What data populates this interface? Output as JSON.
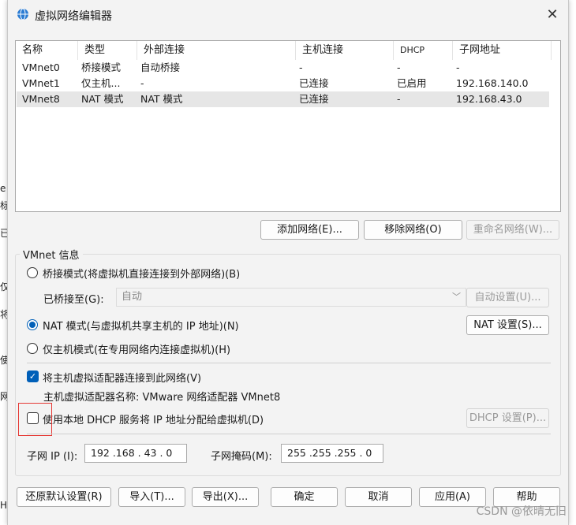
{
  "window": {
    "title": "虚拟网络编辑器",
    "close_glyph": "✕"
  },
  "table": {
    "headers": [
      "名称",
      "类型",
      "外部连接",
      "主机连接",
      "DHCP",
      "子网地址"
    ],
    "rows": [
      [
        "VMnet0",
        "桥接模式",
        "自动桥接",
        "-",
        "-",
        "-"
      ],
      [
        "VMnet1",
        "仅主机...",
        "-",
        "已连接",
        "已启用",
        "192.168.140.0"
      ],
      [
        "VMnet8",
        "NAT 模式",
        "NAT 模式",
        "已连接",
        "-",
        "192.168.43.0"
      ]
    ],
    "selected_row": 2
  },
  "table_buttons": {
    "add": "添加网络(E)...",
    "remove": "移除网络(O)",
    "rename": "重命名网络(W)..."
  },
  "info": {
    "title": "VMnet 信息",
    "bridge_radio": "桥接模式(将虚拟机直接连接到外部网络)(B)",
    "bridged_to_label": "已桥接至(G):",
    "bridged_to_value": "自动",
    "auto_settings": "自动设置(U)...",
    "nat_radio": "NAT 模式(与虚拟机共享主机的 IP 地址)(N)",
    "nat_settings": "NAT 设置(S)...",
    "hostonly_radio": "仅主机模式(在专用网络内连接虚拟机)(H)",
    "connect_adapter": "将主机虚拟适配器连接到此网络(V)",
    "adapter_name": "主机虚拟适配器名称: VMware 网络适配器 VMnet8",
    "use_dhcp": "使用本地 DHCP 服务将 IP 地址分配给虚拟机(D)",
    "dhcp_settings": "DHCP 设置(P)...",
    "subnet_ip_label": "子网 IP (I):",
    "subnet_ip": "192 .168 . 43  .  0",
    "subnet_mask_label": "子网掩码(M):",
    "subnet_mask": "255 .255 .255 .  0"
  },
  "bottom_buttons": {
    "restore": "还原默认设置(R)",
    "import": "导入(T)...",
    "export": "导出(X)...",
    "ok": "确定",
    "cancel": "取消",
    "apply": "应用(A)",
    "help": "帮助"
  },
  "watermark": "CSDN @依晴无旧",
  "background_fragments": [
    "e",
    "标",
    "已",
    "仅",
    "将",
    "使",
    "网",
    "HC"
  ],
  "colors": {
    "accent": "#005fb8",
    "highlight": "#e53935"
  }
}
